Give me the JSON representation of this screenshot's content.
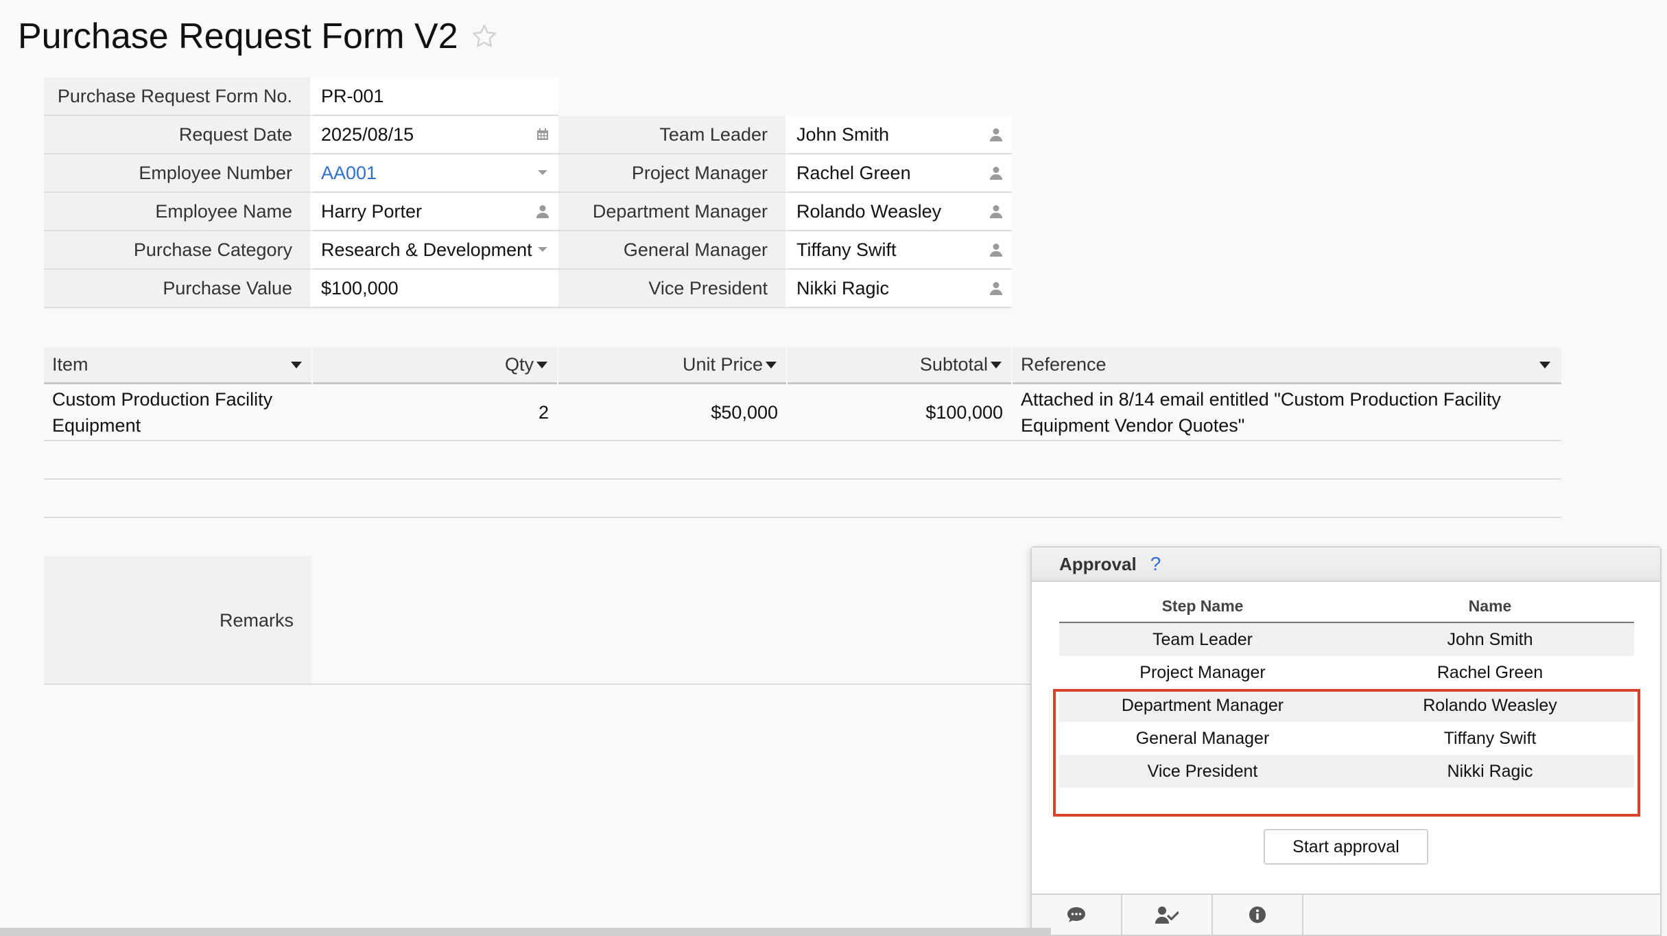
{
  "page": {
    "title": "Purchase Request Form V2"
  },
  "form": {
    "form_no": {
      "label": "Purchase Request Form No.",
      "value": "PR-001"
    },
    "request_date": {
      "label": "Request Date",
      "value": "2025/08/15"
    },
    "employee_number": {
      "label": "Employee Number",
      "value": "AA001"
    },
    "employee_name": {
      "label": "Employee Name",
      "value": "Harry Porter"
    },
    "purchase_category": {
      "label": "Purchase Category",
      "value": "Research & Development"
    },
    "purchase_value": {
      "label": "Purchase Value",
      "value": "$100,000"
    },
    "team_leader": {
      "label": "Team Leader",
      "value": "John Smith"
    },
    "project_manager": {
      "label": "Project Manager",
      "value": "Rachel Green"
    },
    "department_manager": {
      "label": "Department Manager",
      "value": "Rolando Weasley"
    },
    "general_manager": {
      "label": "General Manager",
      "value": "Tiffany Swift"
    },
    "vice_president": {
      "label": "Vice President",
      "value": "Nikki Ragic"
    }
  },
  "items_grid": {
    "columns": [
      "Item",
      "Qty",
      "Unit Price",
      "Subtotal",
      "Reference"
    ],
    "rows": [
      {
        "item": "Custom Production Facility Equipment",
        "qty": "2",
        "unit_price": "$50,000",
        "subtotal": "$100,000",
        "reference": "Attached in 8/14 email entitled \"Custom Production Facility Equipment Vendor Quotes\""
      }
    ]
  },
  "remarks": {
    "label": "Remarks",
    "value": ""
  },
  "approval": {
    "title": "Approval",
    "help": "?",
    "columns": [
      "Step Name",
      "Name"
    ],
    "steps": [
      {
        "step": "Team Leader",
        "name": "John Smith"
      },
      {
        "step": "Project Manager",
        "name": "Rachel Green"
      },
      {
        "step": "Department Manager",
        "name": "Rolando Weasley"
      },
      {
        "step": "General Manager",
        "name": "Tiffany Swift"
      },
      {
        "step": "Vice President",
        "name": "Nikki Ragic"
      }
    ],
    "start_button": "Start approval",
    "highlight_color": "#d9432b"
  },
  "tabs": [
    "comment-icon",
    "user-check-icon",
    "info-icon"
  ],
  "colors": {
    "link": "#2f6fd0",
    "label_bg": "#f1f1f1"
  }
}
